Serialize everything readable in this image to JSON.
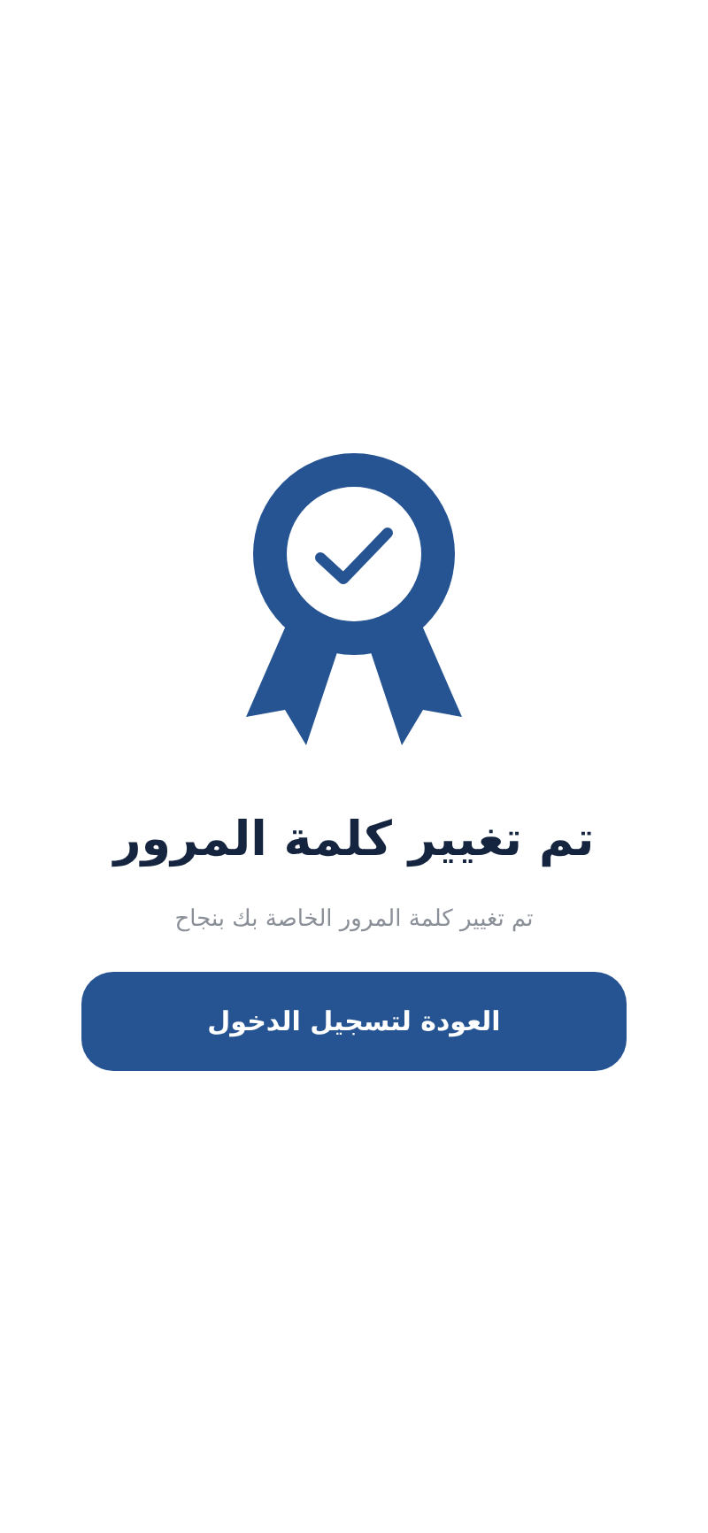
{
  "title": "تم تغيير كلمة المرور",
  "subtitle": "تم تغيير كلمة المرور الخاصة بك بنجاح",
  "button": {
    "label": "العودة لتسجيل الدخول"
  }
}
